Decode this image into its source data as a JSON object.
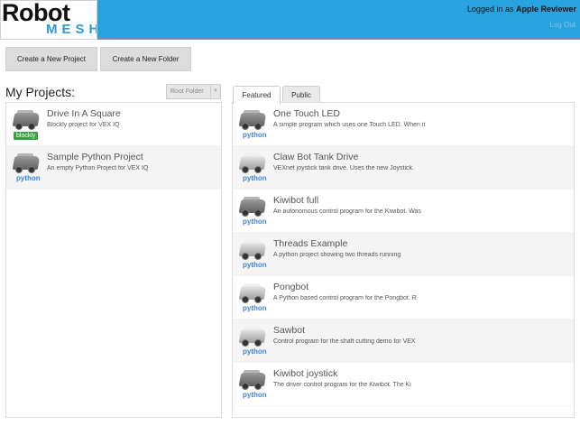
{
  "header": {
    "logo_top": "Robot",
    "logo_bottom": "MESH",
    "login_prefix": "Logged in as ",
    "user_name": "Apple Reviewer",
    "logout_label": "Log Out"
  },
  "actions": {
    "new_project_label": "Create a New Project",
    "new_folder_label": "Create a New Folder"
  },
  "my_projects": {
    "title": "My Projects:",
    "folder_selected": "Root Folder",
    "items": [
      {
        "name": "Drive In A Square",
        "desc": "Blockly project for VEX IQ",
        "lang": "blockly"
      },
      {
        "name": "Sample Python Project",
        "desc": "An empty Python Project for VEX IQ",
        "lang": "python"
      }
    ]
  },
  "tabs": {
    "featured_label": "Featured",
    "public_label": "Public"
  },
  "featured": {
    "items": [
      {
        "name": "One Touch LED",
        "desc": "A simple program which uses one Touch LED.  When it",
        "lang": "python"
      },
      {
        "name": "Claw Bot Tank Drive",
        "desc": "VEXnet joystick tank drive. Uses the new Joystick.",
        "lang": "python"
      },
      {
        "name": "Kiwibot full",
        "desc": "An autonomous control program for the Kiwibot.  Was",
        "lang": "python"
      },
      {
        "name": "Threads Example",
        "desc": "A python project showing two threads running",
        "lang": "python"
      },
      {
        "name": "Pongbot",
        "desc": "A Python based control program for the Pongbot.  R",
        "lang": "python"
      },
      {
        "name": "Sawbot",
        "desc": "Control program for the shaft cutting demo for VEX",
        "lang": "python"
      },
      {
        "name": "Kiwibot joystick",
        "desc": "The driver control program for the Kiwibot.  The Ki",
        "lang": "python"
      }
    ]
  },
  "colors": {
    "header_blue": "#29a3e0",
    "python_blue": "#3a86d8",
    "blockly_green": "#3aa141"
  }
}
